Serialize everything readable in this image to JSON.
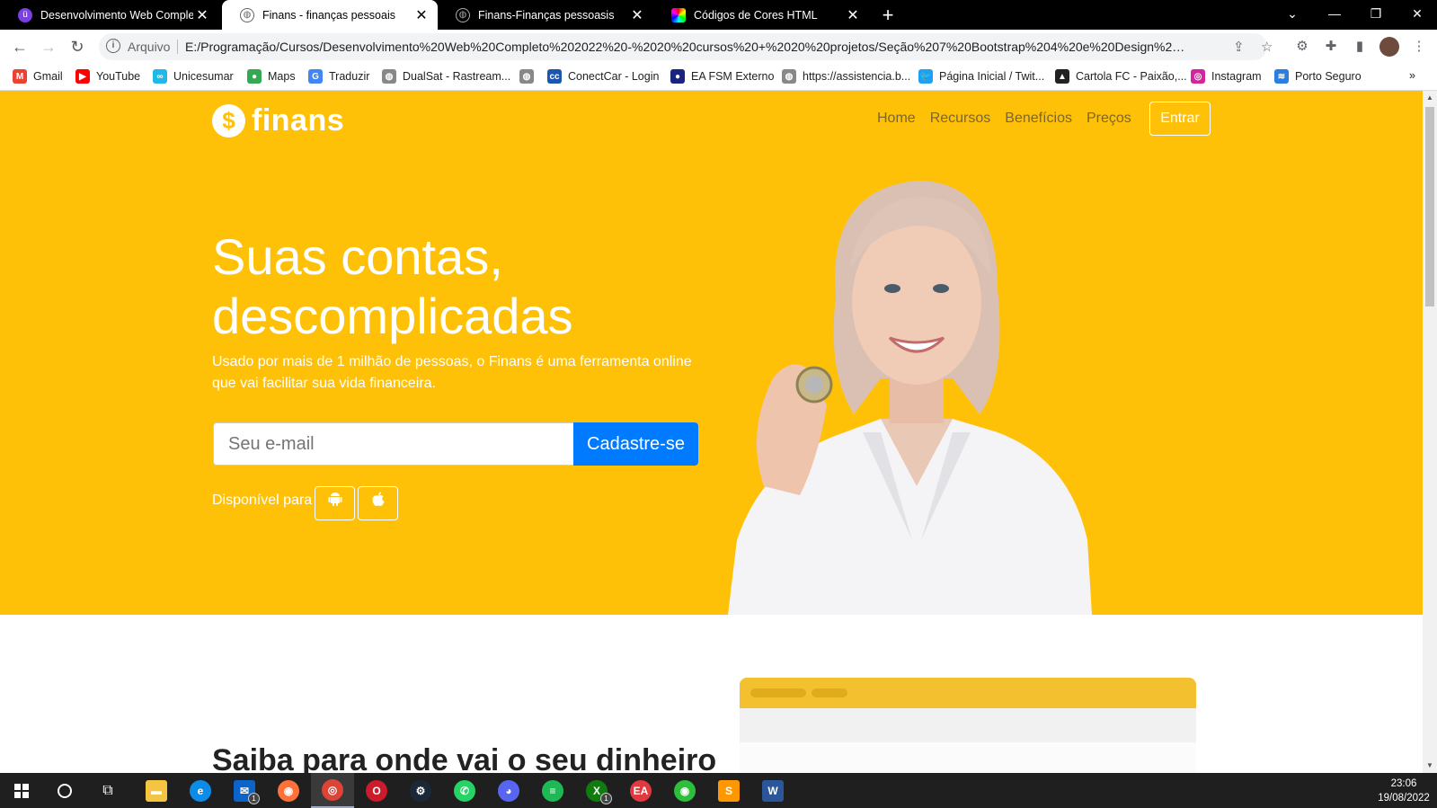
{
  "tabs": [
    {
      "title": "Desenvolvimento Web Completo",
      "active": false
    },
    {
      "title": "Finans - finanças pessoais",
      "active": true
    },
    {
      "title": "Finans-Finanças pessoasis",
      "active": false
    },
    {
      "title": "Códigos de Cores HTML",
      "active": false
    }
  ],
  "toolbar": {
    "scheme": "Arquivo",
    "url": "E:/Programação/Cursos/Desenvolvimento%20Web%20Completo%202022%20-%2020%20cursos%20+%2020%20projetos/Seção%207%20Bootstrap%204%20e%20Design%20responsiv..."
  },
  "bookmarks": [
    {
      "label": "Gmail",
      "icon": "gmail-icon",
      "color": "#ea4335",
      "glyph": "M"
    },
    {
      "label": "YouTube",
      "icon": "youtube-icon",
      "color": "#ff0000",
      "glyph": "▶"
    },
    {
      "label": "Unicesumar",
      "icon": "unicesumar-icon",
      "color": "#1fb8e8",
      "glyph": "∞"
    },
    {
      "label": "Maps",
      "icon": "maps-icon",
      "color": "#34a853",
      "glyph": "●"
    },
    {
      "label": "Traduzir",
      "icon": "translate-icon",
      "color": "#4285f4",
      "glyph": "G"
    },
    {
      "label": "DualSat - Rastream...",
      "icon": "globe-icon",
      "color": "#888888",
      "glyph": "◍"
    },
    {
      "label": "",
      "icon": "globe-icon",
      "color": "#888888",
      "glyph": "◍"
    },
    {
      "label": "ConectCar - Login",
      "icon": "conectcar-icon",
      "color": "#1a56b0",
      "glyph": "cc"
    },
    {
      "label": "EA FSM Externo",
      "icon": "ea-fsm-icon",
      "color": "#1a237e",
      "glyph": "●"
    },
    {
      "label": "https://assistencia.b...",
      "icon": "globe-icon",
      "color": "#888888",
      "glyph": "◍"
    },
    {
      "label": "Página Inicial / Twit...",
      "icon": "twitter-icon",
      "color": "#1da1f2",
      "glyph": "🐦"
    },
    {
      "label": "Cartola FC - Paixão,...",
      "icon": "cartola-icon",
      "color": "#222222",
      "glyph": "▲"
    },
    {
      "label": "Instagram",
      "icon": "instagram-icon",
      "color": "#d6249f",
      "glyph": "◎"
    },
    {
      "label": "Porto Seguro",
      "icon": "porto-seguro-icon",
      "color": "#2a7de1",
      "glyph": "≋"
    }
  ],
  "site": {
    "logo_symbol": "$",
    "logo_text": "finans",
    "nav": [
      "Home",
      "Recursos",
      "Benefícios",
      "Preços"
    ],
    "login_label": "Entrar",
    "hero_title_line1": "Suas contas,",
    "hero_title_line2": "descomplicadas",
    "hero_lead": "Usado por mais de 1 milhão de pessoas, o Finans é uma ferramenta online que vai facilitar sua vida financeira.",
    "email_placeholder": "Seu e-mail",
    "signup_label": "Cadastre-se",
    "available_label": "Disponível para",
    "section_title": "Saiba para onde vai o seu dinheiro"
  },
  "colors": {
    "hero_bg": "#ffc107",
    "signup_bg": "#007bff",
    "dashboard_top": "#f3c12f"
  },
  "taskbar": {
    "apps": [
      {
        "name": "file-explorer-icon",
        "color": "#f4c542",
        "glyph": "▬"
      },
      {
        "name": "edge-icon",
        "color": "#0c8ce9",
        "glyph": "e"
      },
      {
        "name": "mail-icon",
        "color": "#0a64c9",
        "glyph": "✉",
        "badge": "1"
      },
      {
        "name": "firefox-icon",
        "color": "#ff7139",
        "glyph": "◉"
      },
      {
        "name": "chrome-icon",
        "color": "#db4437",
        "glyph": "◎",
        "active": true
      },
      {
        "name": "opera-icon",
        "color": "#cc1b2b",
        "glyph": "O"
      },
      {
        "name": "steam-icon",
        "color": "#1b2838",
        "glyph": "⚙"
      },
      {
        "name": "whatsapp-icon",
        "color": "#25d366",
        "glyph": "✆"
      },
      {
        "name": "discord-icon",
        "color": "#5865f2",
        "glyph": "◕"
      },
      {
        "name": "spotify-icon",
        "color": "#1db954",
        "glyph": "≡"
      },
      {
        "name": "xbox-icon",
        "color": "#107c10",
        "glyph": "X",
        "badge": "1"
      },
      {
        "name": "ea-app-icon",
        "color": "#e03a3e",
        "glyph": "EA"
      },
      {
        "name": "podcast-icon",
        "color": "#2dbe3c",
        "glyph": "◉"
      },
      {
        "name": "sublime-text-icon",
        "color": "#ff9800",
        "glyph": "S"
      },
      {
        "name": "word-icon",
        "color": "#2b579a",
        "glyph": "W"
      }
    ],
    "time": "23:06",
    "date": "19/08/2022"
  }
}
